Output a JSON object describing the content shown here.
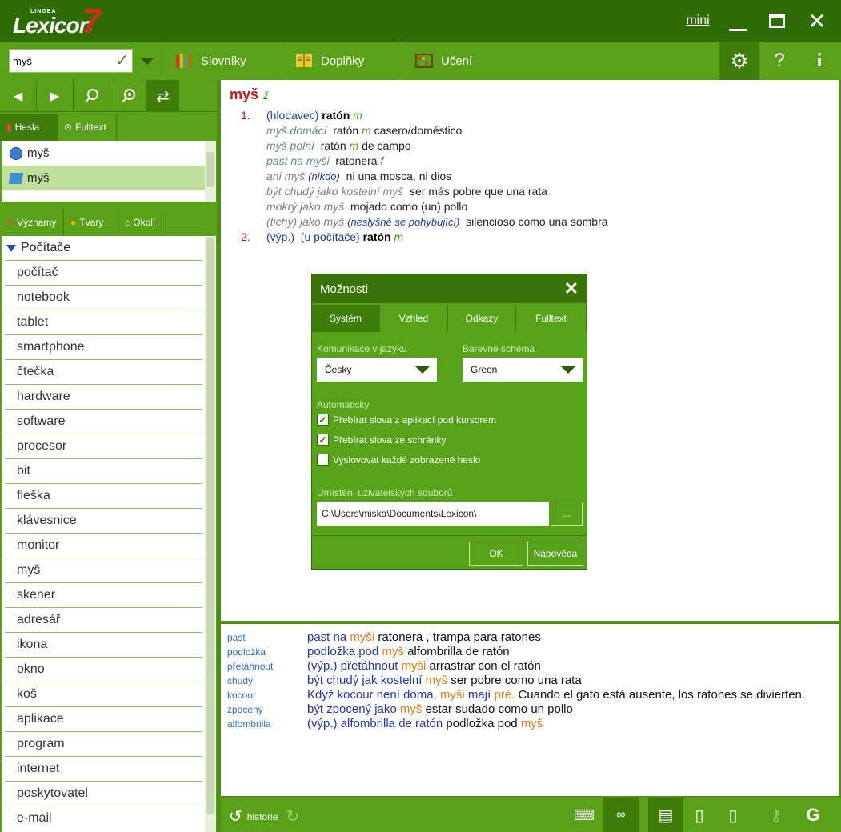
{
  "app": {
    "logo_small": "LINGEA",
    "logo_main": "Lexicon",
    "logo_number": "7",
    "mini_label": "mini"
  },
  "toolbar": {
    "search_value": "myš",
    "tabs": [
      {
        "label": "Slovníky"
      },
      {
        "label": "Doplňky"
      },
      {
        "label": "Učení"
      }
    ],
    "help": "?",
    "info": "i"
  },
  "left": {
    "subtabs1": [
      "Hesla",
      "Fulltext"
    ],
    "headwords": [
      "myš",
      "myš"
    ],
    "subtabs2": [
      "Významy",
      "Tvary",
      "Okolí"
    ],
    "category": "Počítače",
    "words": [
      "počítač",
      "notebook",
      "tablet",
      "smartphone",
      "čtečka",
      "hardware",
      "software",
      "procesor",
      "bit",
      "fleška",
      "klávesnice",
      "monitor",
      "myš",
      "skener",
      "adresář",
      "ikona",
      "okno",
      "koš",
      "aplikace",
      "program",
      "internet",
      "poskytovatel",
      "e-mail"
    ]
  },
  "entry": {
    "headword": "myš",
    "gender": "ž",
    "s1_num": "1.",
    "s1_label": "(hlodavec)",
    "s1_tr": "ratón",
    "s1_g": "m",
    "ex1_a": "myš domácí",
    "ex1_b": "ratón",
    "ex1_g": "m",
    "ex1_c": "casero/doméstico",
    "ex2_a": "myš polní",
    "ex2_b": "ratón",
    "ex2_g": "m",
    "ex2_c": "de campo",
    "ex3_a": "past na myši",
    "ex3_b": "ratonera",
    "ex3_g": "f",
    "ex4_a": "ani myš",
    "ex4_l": "(nikdo)",
    "ex4_c": "ni una mosca, ni dios",
    "ex5_a": "být chudý jako kostelní myš",
    "ex5_c": "ser más pobre que una rata",
    "ex6_a": "mokrý jako myš",
    "ex6_c": "mojado como (un) pollo",
    "ex7_a": "(tichý) jako myš",
    "ex7_l": "(neslyšně se pohybující)",
    "ex7_c": "silencioso como una sombra",
    "s2_num": "2.",
    "s2_label": "(výp.)",
    "s2_label2": "(u počítače)",
    "s2_tr": "ratón",
    "s2_g": "m"
  },
  "bottom": [
    {
      "key": "past"
    },
    {
      "key": "podložka"
    },
    {
      "key": "přetáhnout"
    },
    {
      "key": "chudý"
    },
    {
      "key": "kocour"
    },
    {
      "key": "zpocený"
    },
    {
      "key": "alfombrilla"
    }
  ],
  "bottom_text": {
    "r0a": "past na ",
    "r0b": "myši",
    "r0c": "  ratonera , trampa  para ratones",
    "r1a": "podložka pod ",
    "r1b": "myš",
    "r1c": "  alfombrilla  de ratón",
    "r2a": "(výp.) přetáhnout ",
    "r2b": "myši",
    "r2c": "  arrastrar con el ratón",
    "r3a": "být chudý jak kostelní ",
    "r3b": "myš",
    "r3c": "  ser pobre como una rata",
    "r4a": "Když kocour není doma, ",
    "r4b": "myši",
    "r4a2": " mají ",
    "r4b2": "pré.",
    "r4c": "  Cuando el gato está ausente, los ratones se divierten.",
    "r5a": "být zpocený jako ",
    "r5b": "myš",
    "r5c": "  estar sudado como un pollo",
    "r6a": "(výp.) alfombrilla de ratón",
    "r6c": "  podložka pod ",
    "r6b": "myš"
  },
  "status": {
    "history": "historie"
  },
  "dialog": {
    "title": "Možnosti",
    "tabs": [
      "Systém",
      "Vzhled",
      "Odkazy",
      "Fulltext"
    ],
    "lang_label": "Komunikace v jazyku",
    "lang_value": "Česky",
    "scheme_label": "Barevné schéma",
    "scheme_value": "Green",
    "auto_label": "Automaticky",
    "checks": [
      {
        "label": "Přebírat slova z aplikací pod kursorem",
        "checked": true
      },
      {
        "label": "Přebírat slova ze schránky",
        "checked": true
      },
      {
        "label": "Vyslovovat každé zobrazené heslo",
        "checked": false
      }
    ],
    "path_label": "Umístění uživatelských souborů",
    "path_value": "C:\\Users\\miska\\Documents\\Lexicon\\",
    "browse": "...",
    "ok": "OK",
    "help": "Nápověda"
  },
  "colors": {
    "dark_green": "#2e6c06",
    "green": "#5aa11a",
    "red": "#c21a1a",
    "blue": "#2233bb",
    "orange": "#e87a14"
  }
}
